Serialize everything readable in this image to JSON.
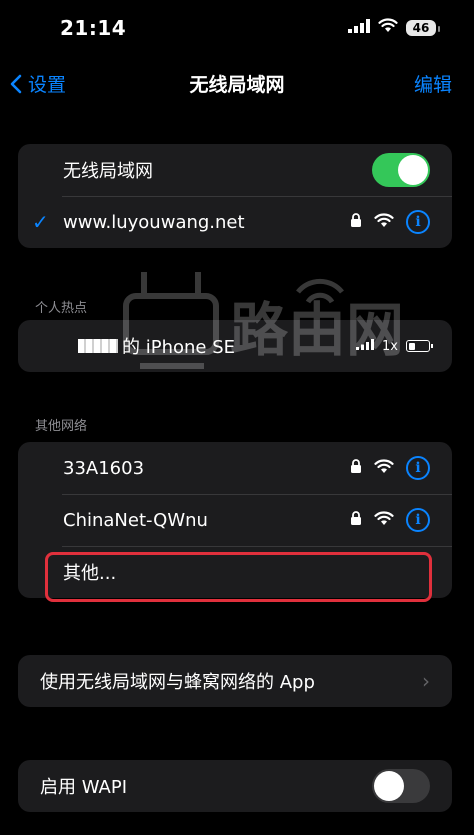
{
  "status": {
    "time": "21:14",
    "battery": "46"
  },
  "nav": {
    "back_label": "设置",
    "title": "无线局域网",
    "edit_label": "编辑"
  },
  "wifi": {
    "toggle_label": "无线局域网",
    "toggle_on": true,
    "connected_network": "www.luyouwang.net"
  },
  "hotspot": {
    "section_label": "个人热点",
    "device_suffix": "的 iPhone SE",
    "signal_type": "1x"
  },
  "other": {
    "section_label": "其他网络",
    "networks": [
      {
        "name": "33A1603"
      },
      {
        "name": "ChinaNet-QWnu"
      }
    ],
    "other_label": "其他..."
  },
  "apps": {
    "label": "使用无线局域网与蜂窝网络的 App"
  },
  "wapi": {
    "label": "启用 WAPI",
    "toggle_on": false
  },
  "watermark": {
    "text": "路由网"
  },
  "colors": {
    "accent": "#0a84ff",
    "toggle_on": "#34c759",
    "highlight": "#e0303c"
  }
}
